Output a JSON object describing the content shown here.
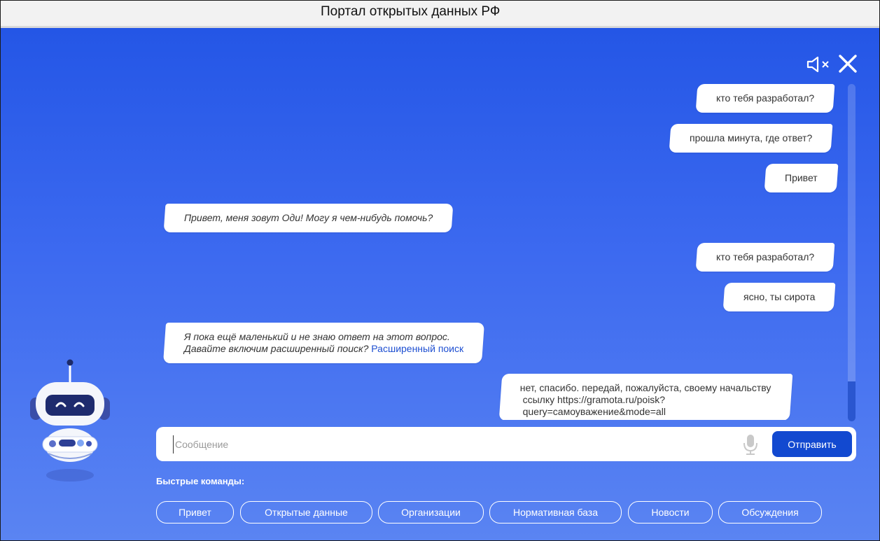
{
  "window": {
    "title": "Портал открытых данных РФ"
  },
  "controls": {
    "mute_icon": "speaker-muted-icon",
    "close_icon": "close-icon"
  },
  "messages": [
    {
      "from": "user",
      "text": "кто тебя разработал?"
    },
    {
      "from": "user",
      "text": "прошла минута, где ответ?"
    },
    {
      "from": "user",
      "text": "Привет"
    },
    {
      "from": "bot",
      "text": "Привет, меня зовут Оди! Могу я чем-нибудь помочь?"
    },
    {
      "from": "user",
      "text": "кто тебя разработал?"
    },
    {
      "from": "user",
      "text": "ясно, ты сирота"
    },
    {
      "from": "bot",
      "line1": "Я пока ещё маленький и не знаю ответ на этот вопрос.",
      "line2": "Давайте включим расширенный поиск?",
      "link": "Расширенный поиск"
    },
    {
      "from": "user",
      "line1": "нет, спасибо. передай, пожалуйста, своему начальству",
      "line2": "ссылку https://gramota.ru/poisk?",
      "line3": "query=самоуважение&mode=all"
    }
  ],
  "input": {
    "placeholder": "Сообщение",
    "value": ""
  },
  "send_label": "Отправить",
  "quick_commands": {
    "label": "Быстрые команды:",
    "items": [
      "Привет",
      "Открытые данные",
      "Организации",
      "Нормативная база",
      "Новости",
      "Обсуждения"
    ]
  },
  "colors": {
    "panel_top": "#2456e6",
    "panel_bottom": "#5a84f2",
    "send_button": "#1249d0",
    "link": "#1e4fd1"
  }
}
